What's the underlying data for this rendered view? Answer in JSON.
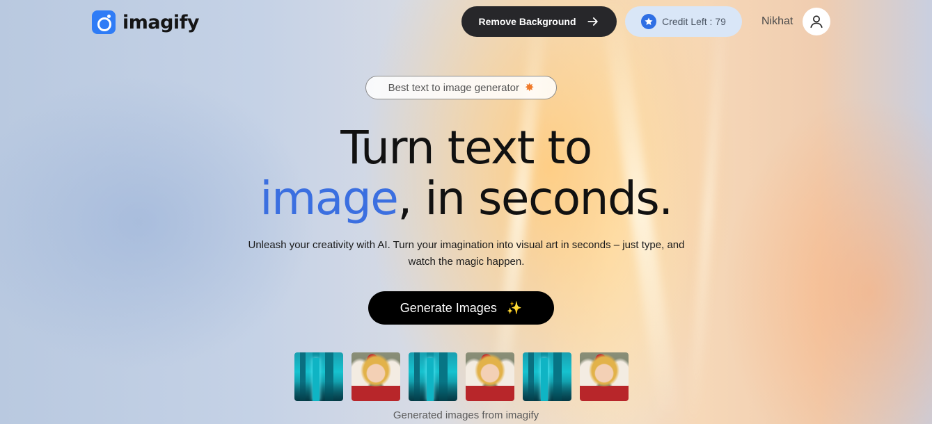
{
  "brand": {
    "name": "imagify",
    "accent_color": "#2f7cf6"
  },
  "header": {
    "remove_bg_label": "Remove Background",
    "credit_label": "Credit Left : 79",
    "user_name": "Nikhat"
  },
  "hero": {
    "tag_label": "Best text to image generator",
    "headline_line1": "Turn text to",
    "headline_accent": "image",
    "headline_rest": ", in seconds.",
    "subtext": "Unleash your creativity with AI. Turn your imagination into visual art in seconds – just type, and watch the magic happen.",
    "generate_label": "Generate Images",
    "accent_color": "#3b6fe0"
  },
  "gallery": {
    "caption": "Generated images from imagify",
    "thumbnails": [
      "city",
      "doll",
      "city",
      "doll",
      "city",
      "doll"
    ]
  },
  "icons": [
    "logo-icon",
    "arrow-right-icon",
    "star-icon",
    "user-icon",
    "badge-icon",
    "sparkle-icon"
  ]
}
